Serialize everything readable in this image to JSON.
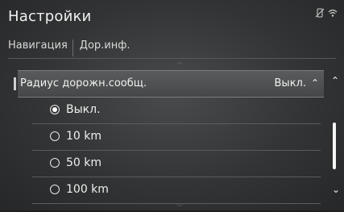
{
  "header": {
    "title": "Настройки",
    "status_icons": [
      "no-phone-icon",
      "wifi-icon"
    ]
  },
  "breadcrumb": [
    "Навигация",
    "Дор.инф."
  ],
  "setting": {
    "label": "Радиус дорожн.сообщ.",
    "value": "Выкл."
  },
  "options": [
    {
      "label": "Выкл.",
      "selected": true
    },
    {
      "label": "10 km",
      "selected": false
    },
    {
      "label": "50 km",
      "selected": false
    },
    {
      "label": "100 km",
      "selected": false
    }
  ],
  "colors": {
    "background": "#333435",
    "text": "#f0f0f0",
    "scroll_thumb": "#f5f5f5"
  }
}
